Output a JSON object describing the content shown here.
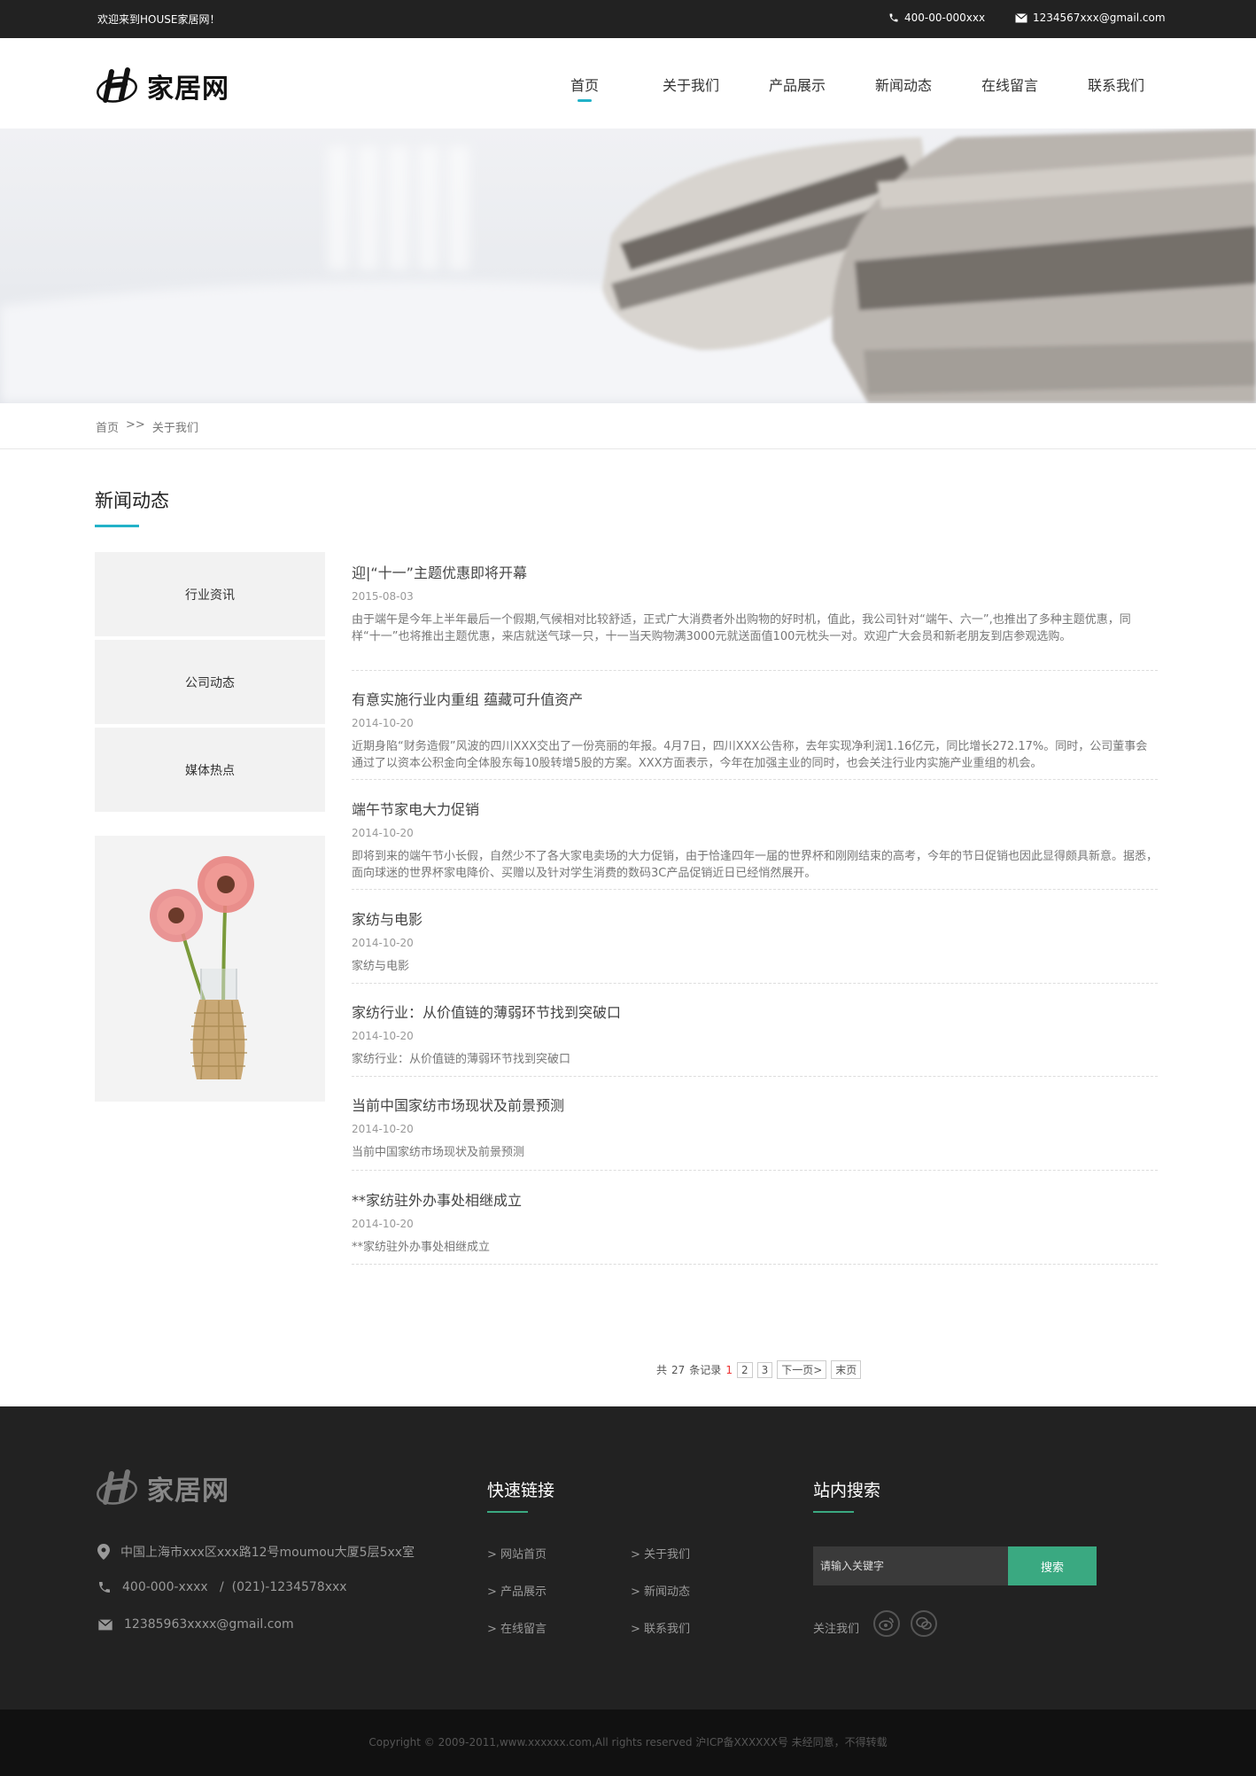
{
  "topbar": {
    "welcome": "欢迎来到HOUSE家居网！",
    "phone": "400-00-000xxx",
    "email": "1234567xxx@gmail.com"
  },
  "header": {
    "logo_text": "家居网",
    "nav": [
      "首页",
      "关于我们",
      "产品展示",
      "新闻动态",
      "在线留言",
      "联系我们"
    ],
    "active_nav": "首页"
  },
  "breadcrumb": {
    "home": "首页",
    "separator": ">>",
    "current": "关于我们"
  },
  "section": {
    "title": "新闻动态"
  },
  "categories": [
    "行业资讯",
    "公司动态",
    "媒体热点"
  ],
  "news": [
    {
      "title": "迎|“十一”主题优惠即将开幕",
      "date": "2015-08-03",
      "summary": "由于端午是今年上半年最后一个假期,气候相对比较舒适，正式广大消费者外出购物的好时机，值此，我公司针对“端午、六一”,也推出了多种主题优惠，同样“十一”也将推出主题优惠，来店就送气球一只，十一当天购物满3000元就送面值100元枕头一对。欢迎广大会员和新老朋友到店参观选购。"
    },
    {
      "title": "有意实施行业内重组 蕴藏可升值资产",
      "date": "2014-10-20",
      "summary": "近期身陷“财务造假”风波的四川XXX交出了一份亮丽的年报。4月7日，四川XXX公告称，去年实现净利润1.16亿元，同比增长272.17%。同时，公司董事会通过了以资本公积金向全体股东每10股转增5股的方案。XXX方面表示，今年在加强主业的同时，也会关注行业内实施产业重组的机会。"
    },
    {
      "title": "端午节家电大力促销",
      "date": "2014-10-20",
      "summary": "即将到来的端午节小长假，自然少不了各大家电卖场的大力促销，由于恰逢四年一届的世界杯和刚刚结束的高考，今年的节日促销也因此显得颇具新意。据悉，面向球迷的世界杯家电降价、买赠以及针对学生消费的数码3C产品促销近日已经悄然展开。"
    },
    {
      "title": "家纺与电影",
      "date": "2014-10-20",
      "summary": "家纺与电影"
    },
    {
      "title": "家纺行业：从价值链的薄弱环节找到突破口",
      "date": "2014-10-20",
      "summary": "家纺行业：从价值链的薄弱环节找到突破口"
    },
    {
      "title": "当前中国家纺市场现状及前景预测",
      "date": "2014-10-20",
      "summary": "当前中国家纺市场现状及前景预测"
    },
    {
      "title": "**家纺驻外办事处相继成立",
      "date": "2014-10-20",
      "summary": "**家纺驻外办事处相继成立"
    }
  ],
  "pager": {
    "total_prefix": "共",
    "total": "27",
    "total_suffix": "条记录",
    "current": "1",
    "pages": [
      "2",
      "3"
    ],
    "next": "下一页>",
    "last": "末页"
  },
  "footer": {
    "logo_text": "家居网",
    "address": "中国上海市xxx区xxx路12号moumou大厦5层5xx室",
    "phones": "400-000-xxxx   /  (021)-1234578xxx",
    "email": "12385963xxxx@gmail.com",
    "quick_links_title": "快速链接",
    "quick_links": [
      "> 网站首页",
      "> 关于我们",
      "> 产品展示",
      "> 新闻动态",
      "> 在线留言",
      "> 联系我们"
    ],
    "search_title": "站内搜索",
    "search_placeholder": "请输入关键字",
    "search_button": "搜索",
    "follow_label": "关注我们"
  },
  "copyright": "Copyright © 2009-2011,www.xxxxxx.com,All rights reserved  沪ICP备XXXXXX号 未经同意，不得转载",
  "colors": {
    "accent": "#22b2c8",
    "footer_green": "#3aa981",
    "topbar_bg": "#222222",
    "footer_bg": "#222222"
  }
}
